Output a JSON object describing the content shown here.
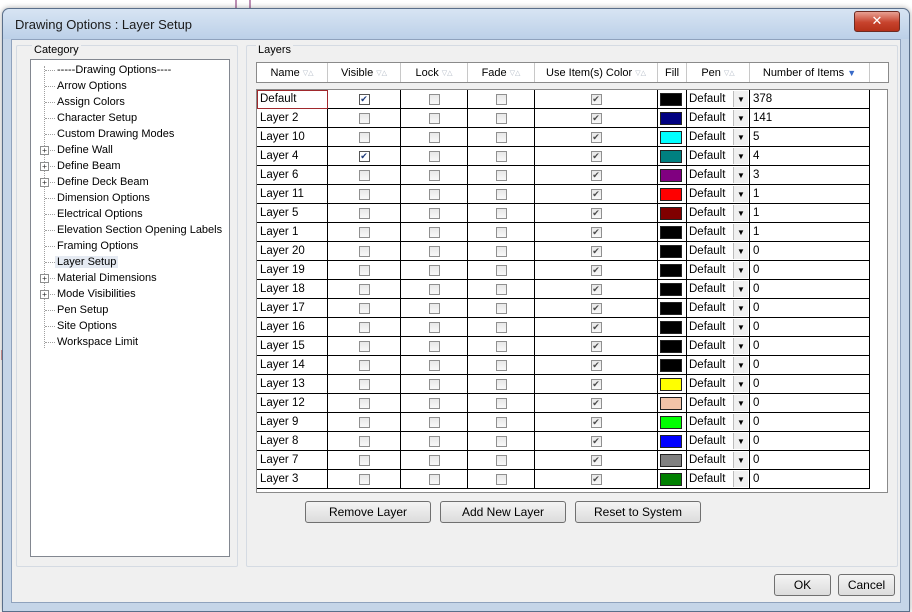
{
  "window": {
    "title": "Drawing Options : Layer Setup",
    "close_glyph": "✕"
  },
  "category": {
    "label": "Category",
    "items": [
      {
        "label": "-----Drawing Options----",
        "expandable": false
      },
      {
        "label": "Arrow Options",
        "expandable": false
      },
      {
        "label": "Assign Colors",
        "expandable": false
      },
      {
        "label": "Character Setup",
        "expandable": false
      },
      {
        "label": "Custom Drawing Modes",
        "expandable": false
      },
      {
        "label": "Define Wall",
        "expandable": true
      },
      {
        "label": "Define Beam",
        "expandable": true
      },
      {
        "label": "Define Deck Beam",
        "expandable": true
      },
      {
        "label": "Dimension Options",
        "expandable": false
      },
      {
        "label": "Electrical Options",
        "expandable": false
      },
      {
        "label": "Elevation Section Opening Labels",
        "expandable": false
      },
      {
        "label": "Framing Options",
        "expandable": false
      },
      {
        "label": "Layer Setup",
        "expandable": false,
        "selected": true
      },
      {
        "label": "Material Dimensions",
        "expandable": true
      },
      {
        "label": "Mode Visibilities",
        "expandable": true
      },
      {
        "label": "Pen Setup",
        "expandable": false
      },
      {
        "label": "Site Options",
        "expandable": false
      },
      {
        "label": "Workspace Limit",
        "expandable": false
      }
    ]
  },
  "layers": {
    "label": "Layers",
    "columns": [
      "Name",
      "Visible",
      "Lock",
      "Fade",
      "Use Item(s) Color",
      "Fill",
      "Pen",
      "Number of Items"
    ],
    "rows": [
      {
        "name": "Default",
        "visible": true,
        "lock": false,
        "fade": false,
        "use_color": true,
        "fill": "#000000",
        "pen": "Default",
        "count": "378"
      },
      {
        "name": "Layer 2",
        "visible": false,
        "lock": false,
        "fade": false,
        "use_color": true,
        "fill": "#000080",
        "pen": "Default",
        "count": "141"
      },
      {
        "name": "Layer 10",
        "visible": false,
        "lock": false,
        "fade": false,
        "use_color": true,
        "fill": "#00ffff",
        "pen": "Default",
        "count": "5"
      },
      {
        "name": "Layer 4",
        "visible": true,
        "lock": false,
        "fade": false,
        "use_color": true,
        "fill": "#008080",
        "pen": "Default",
        "count": "4"
      },
      {
        "name": "Layer 6",
        "visible": false,
        "lock": false,
        "fade": false,
        "use_color": true,
        "fill": "#800080",
        "pen": "Default",
        "count": "3"
      },
      {
        "name": "Layer 11",
        "visible": false,
        "lock": false,
        "fade": false,
        "use_color": true,
        "fill": "#ff0000",
        "pen": "Default",
        "count": "1"
      },
      {
        "name": "Layer 5",
        "visible": false,
        "lock": false,
        "fade": false,
        "use_color": true,
        "fill": "#800000",
        "pen": "Default",
        "count": "1"
      },
      {
        "name": "Layer 1",
        "visible": false,
        "lock": false,
        "fade": false,
        "use_color": true,
        "fill": "#000000",
        "pen": "Default",
        "count": "1"
      },
      {
        "name": "Layer 20",
        "visible": false,
        "lock": false,
        "fade": false,
        "use_color": true,
        "fill": "#000000",
        "pen": "Default",
        "count": "0"
      },
      {
        "name": "Layer 19",
        "visible": false,
        "lock": false,
        "fade": false,
        "use_color": true,
        "fill": "#000000",
        "pen": "Default",
        "count": "0"
      },
      {
        "name": "Layer 18",
        "visible": false,
        "lock": false,
        "fade": false,
        "use_color": true,
        "fill": "#000000",
        "pen": "Default",
        "count": "0"
      },
      {
        "name": "Layer 17",
        "visible": false,
        "lock": false,
        "fade": false,
        "use_color": true,
        "fill": "#000000",
        "pen": "Default",
        "count": "0"
      },
      {
        "name": "Layer 16",
        "visible": false,
        "lock": false,
        "fade": false,
        "use_color": true,
        "fill": "#000000",
        "pen": "Default",
        "count": "0"
      },
      {
        "name": "Layer 15",
        "visible": false,
        "lock": false,
        "fade": false,
        "use_color": true,
        "fill": "#000000",
        "pen": "Default",
        "count": "0"
      },
      {
        "name": "Layer 14",
        "visible": false,
        "lock": false,
        "fade": false,
        "use_color": true,
        "fill": "#000000",
        "pen": "Default",
        "count": "0"
      },
      {
        "name": "Layer 13",
        "visible": false,
        "lock": false,
        "fade": false,
        "use_color": true,
        "fill": "#ffff00",
        "pen": "Default",
        "count": "0"
      },
      {
        "name": "Layer 12",
        "visible": false,
        "lock": false,
        "fade": false,
        "use_color": true,
        "fill": "#f2c4a8",
        "pen": "Default",
        "count": "0"
      },
      {
        "name": "Layer 9",
        "visible": false,
        "lock": false,
        "fade": false,
        "use_color": true,
        "fill": "#00ff00",
        "pen": "Default",
        "count": "0"
      },
      {
        "name": "Layer 8",
        "visible": false,
        "lock": false,
        "fade": false,
        "use_color": true,
        "fill": "#0000ff",
        "pen": "Default",
        "count": "0"
      },
      {
        "name": "Layer 7",
        "visible": false,
        "lock": false,
        "fade": false,
        "use_color": true,
        "fill": "#808080",
        "pen": "Default",
        "count": "0"
      },
      {
        "name": "Layer 3",
        "visible": false,
        "lock": false,
        "fade": false,
        "use_color": true,
        "fill": "#008000",
        "pen": "Default",
        "count": "0"
      }
    ]
  },
  "buttons": {
    "remove": "Remove Layer",
    "add": "Add New Layer",
    "reset": "Reset to System",
    "ok": "OK",
    "cancel": "Cancel"
  },
  "colors": {
    "selection_outline": "#a0282c",
    "window_frame": "#c5d5e8"
  }
}
